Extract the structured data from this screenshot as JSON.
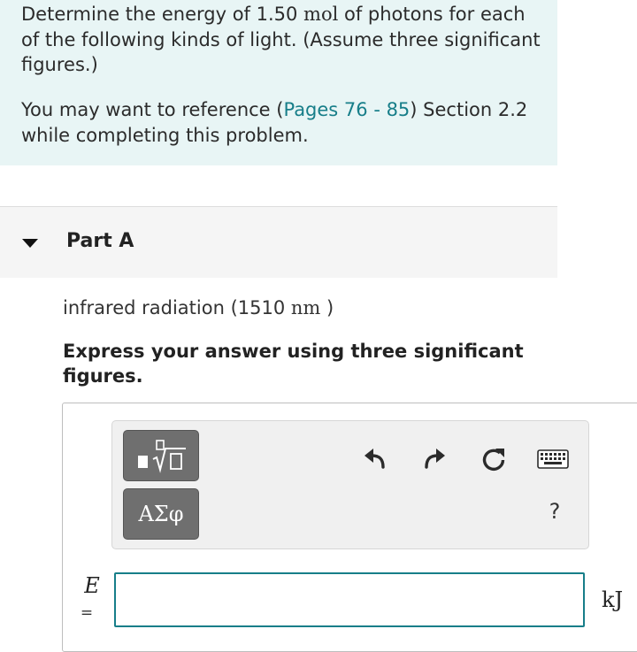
{
  "intro": {
    "line1_before_unit": "Determine the energy of 1.50 ",
    "unit_mol": "mol",
    "line1_after_unit": " of photons for each of the following kinds of light. (Assume three significant figures.)",
    "reference_before": "You may want to reference (",
    "reference_link": "Pages 76 - 85",
    "reference_after": ") Section 2.2 while completing this problem."
  },
  "part": {
    "title": "Part A",
    "question_before": "infrared radiation (1510 ",
    "question_unit": "nm",
    "question_after": " )",
    "instruction": "Express your answer using three significant figures."
  },
  "toolbar": {
    "greek_label": "ΑΣφ",
    "help_label": "?",
    "icons": [
      "templates-icon",
      "undo-icon",
      "redo-icon",
      "reset-icon",
      "keyboard-icon",
      "help-icon"
    ]
  },
  "answer": {
    "variable": "E",
    "equals": "=",
    "value": "",
    "unit": "kJ"
  },
  "colors": {
    "intro_bg": "#e8f5f5",
    "link": "#177e89",
    "input_border": "#177e89",
    "tool_button": "#6f6f6f"
  }
}
